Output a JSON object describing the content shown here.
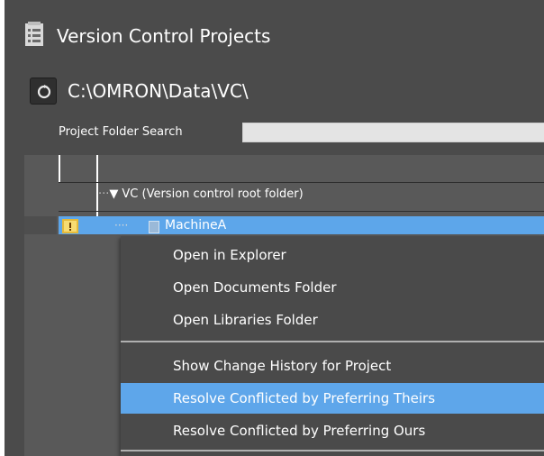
{
  "header": {
    "title": "Version Control Projects",
    "icon": "document-list-icon",
    "path": "C:\\OMRON\\Data\\VC\\",
    "refresh_icon": "refresh-icon"
  },
  "search": {
    "label": "Project Folder Search",
    "value": "",
    "placeholder": ""
  },
  "tree": {
    "root_label": "VC (Version control root folder)",
    "root_expander": "▼",
    "root_prefix": "···",
    "project_label": "MachineA",
    "project_prefix": "····",
    "status_icon": "conflict-warning-icon"
  },
  "context_menu": {
    "items": [
      "Open in Explorer",
      "Open Documents Folder",
      "Open Libraries Folder",
      "Show Change History for Project",
      "Resolve Conflicted by Preferring Theirs",
      "Resolve Conflicted by Preferring Ours"
    ],
    "highlighted_index": 4
  },
  "colors": {
    "panel_bg": "#4b4b4b",
    "tree_bg": "#595959",
    "selection": "#5da6ea",
    "text": "#ffffff"
  }
}
